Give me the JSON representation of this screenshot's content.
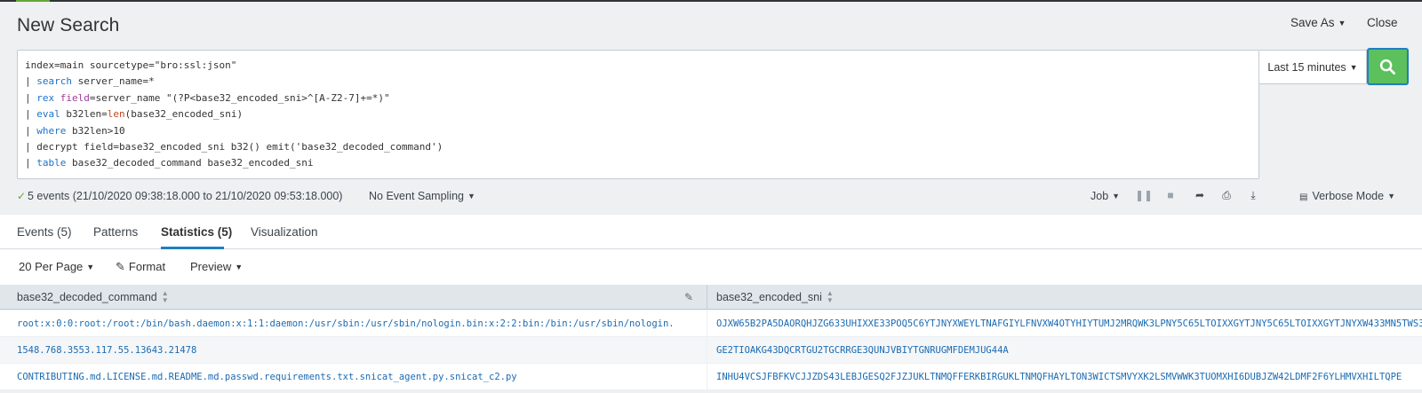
{
  "header": {
    "title": "New Search",
    "save_as_label": "Save As",
    "close_label": "Close"
  },
  "search": {
    "lines": [
      [
        {
          "t": "index=main sourcetype=\"bro:ssl:json\"",
          "c": ""
        }
      ],
      [
        {
          "t": "| ",
          "c": ""
        },
        {
          "t": "search",
          "c": "kw"
        },
        {
          "t": " server_name=*",
          "c": ""
        }
      ],
      [
        {
          "t": "| ",
          "c": ""
        },
        {
          "t": "rex",
          "c": "kw"
        },
        {
          "t": " ",
          "c": ""
        },
        {
          "t": "field",
          "c": "arg"
        },
        {
          "t": "=server_name \"(?P<base32_encoded_sni>^[A-Z2-7]+=*)\"",
          "c": ""
        }
      ],
      [
        {
          "t": "| ",
          "c": ""
        },
        {
          "t": "eval",
          "c": "kw"
        },
        {
          "t": " b32len=",
          "c": ""
        },
        {
          "t": "len",
          "c": "fn"
        },
        {
          "t": "(base32_encoded_sni)",
          "c": ""
        }
      ],
      [
        {
          "t": "| ",
          "c": ""
        },
        {
          "t": "where",
          "c": "kw"
        },
        {
          "t": " b32len>10",
          "c": ""
        }
      ],
      [
        {
          "t": "| decrypt field=base32_encoded_sni b32() emit('base32_decoded_command')",
          "c": ""
        }
      ],
      [
        {
          "t": "| ",
          "c": ""
        },
        {
          "t": "table",
          "c": "kw"
        },
        {
          "t": " base32_decoded_command base32_encoded_sni",
          "c": ""
        }
      ]
    ],
    "time_range": "Last 15 minutes"
  },
  "status": {
    "events_text": "5 events (21/10/2020 09:38:18.000 to 21/10/2020 09:53:18.000)",
    "sampling_label": "No Event Sampling",
    "job_label": "Job",
    "mode_label": "Verbose Mode"
  },
  "tabs": [
    {
      "label": "Events (5)"
    },
    {
      "label": "Patterns"
    },
    {
      "label": "Statistics (5)"
    },
    {
      "label": "Visualization"
    }
  ],
  "toolbar": {
    "per_page_label": "20 Per Page",
    "format_label": "Format",
    "preview_label": "Preview"
  },
  "table": {
    "columns": [
      "base32_decoded_command",
      "base32_encoded_sni"
    ],
    "rows": [
      [
        "root:x:0:0:root:/root:/bin/bash.daemon:x:1:1:daemon:/usr/sbin:/usr/sbin/nologin.bin:x:2:2:bin:/bin:/usr/sbin/nologin.",
        "OJXW65B2PA5DAORQHJZG633UHIXXE33POQ5C6YTJNYXWEYLTNAFGIYLFNVXW4OTYHIYTUMJ2MRQWK3LPNY5C65LTOIXXGYTJNY5C65LTOIXXGYTJNYXW433MN5TWS3"
      ],
      [
        "1548.768.3553.117.55.13643.21478",
        "GE2TIOAKG43DQCRTGU2TGCRRGE3QUNJVBIYTGNRUGMFDEMJUG44A"
      ],
      [
        "CONTRIBUTING.md.LICENSE.md.README.md.passwd.requirements.txt.snicat_agent.py.snicat_c2.py",
        "INHU4VCSJFBFKVCJJZDS43LEBJGESQ2FJZJUKLTNMQFFERKBIRGUKLTNMQFHAYLTON3WICTSMVYXK2LSMVWWK3TUOMXHI6DUBJZW42LDMF2F6YLHMVXHILTQPE"
      ]
    ]
  }
}
